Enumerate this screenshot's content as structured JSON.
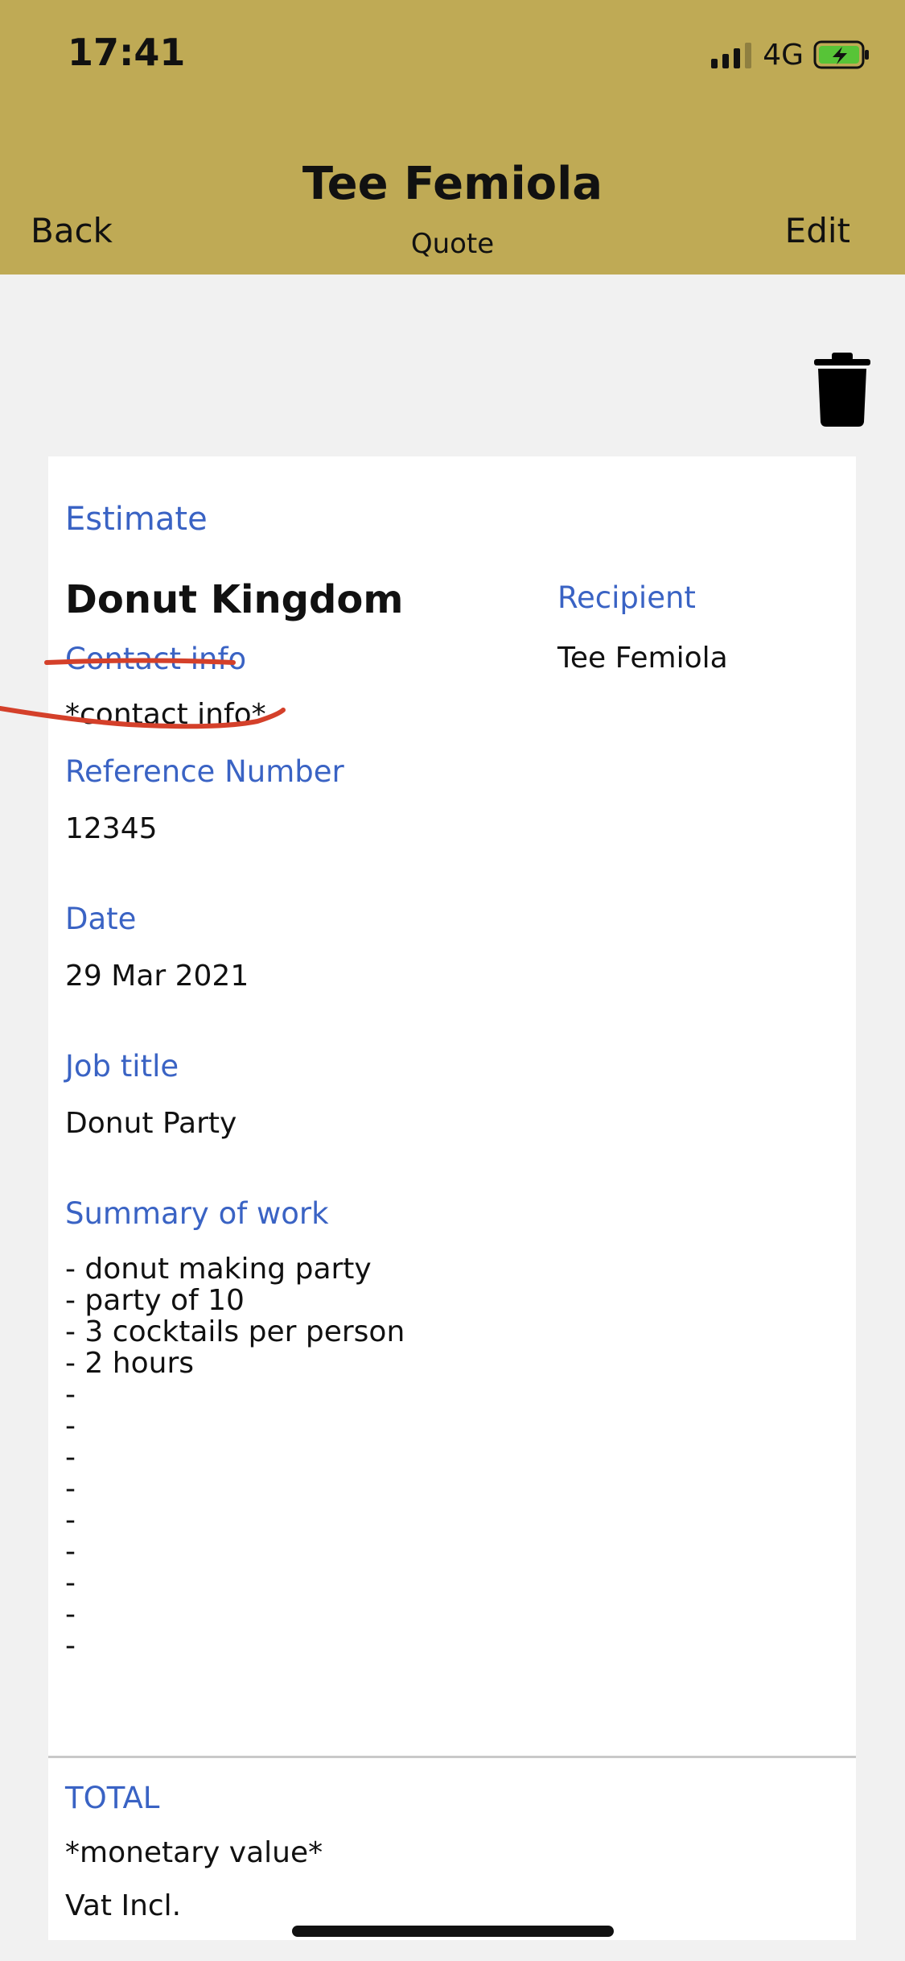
{
  "status_bar": {
    "time": "17:41",
    "network": "4G"
  },
  "nav": {
    "title": "Tee Femiola",
    "subtitle": "Quote",
    "back_label": "Back",
    "edit_label": "Edit"
  },
  "icons": {
    "delete": "trash-icon",
    "battery": "battery-charging-icon",
    "signal": "cellular-signal-icon"
  },
  "colors": {
    "header": "#bfaa55",
    "label": "#3a63c4",
    "annotation": "#d4402a"
  },
  "quote": {
    "heading": "Estimate",
    "company": "Donut Kingdom",
    "contact_label": "Contact info",
    "contact_value": "*contact info*",
    "recipient_label": "Recipient",
    "recipient_value": "Tee Femiola",
    "reference_label": "Reference Number",
    "reference_value": "12345",
    "date_label": "Date",
    "date_value": "29 Mar 2021",
    "job_title_label": "Job title",
    "job_title_value": "Donut Party",
    "summary_label": "Summary of work",
    "summary_text": "- donut making party\n- party of 10\n- 3 cocktails per person\n- 2 hours\n-\n-\n-\n-\n-\n-\n-\n-\n-",
    "total_label": "TOTAL",
    "total_value": "*monetary value*",
    "vat_note": "Vat Incl."
  }
}
